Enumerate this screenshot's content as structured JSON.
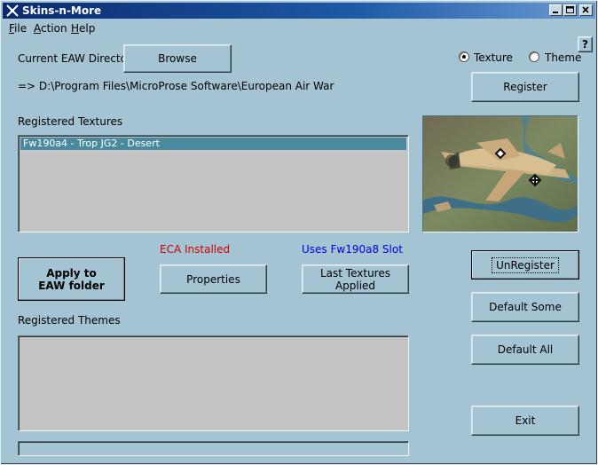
{
  "window": {
    "title": "Skins-n-More",
    "controls": [
      "minimize",
      "maximize",
      "close"
    ]
  },
  "menu": [
    {
      "label": "File",
      "accel": "F"
    },
    {
      "label": "Action",
      "accel": "A"
    },
    {
      "label": "Help",
      "accel": "H"
    }
  ],
  "help_button_label": "?",
  "directory": {
    "label": "Current EAW Directory:",
    "browse_label": "Browse",
    "path_text": "=> D:\\Program Files\\MicroProse Software\\European Air War"
  },
  "mode": {
    "options": [
      {
        "label": "Texture",
        "checked": true
      },
      {
        "label": "Theme",
        "checked": false
      }
    ]
  },
  "register_label": "Register",
  "textures": {
    "heading": "Registered Textures",
    "items": [
      "Fw190a4 - Trop JG2 - Desert"
    ],
    "selected_index": 0
  },
  "status": {
    "eca": "ECA Installed",
    "eca_color": "#d00000",
    "slot": "Uses Fw190a8 Slot",
    "slot_color": "#0000e0"
  },
  "actions": {
    "apply_label": "Apply to EAW folder",
    "properties_label": "Properties",
    "last_textures_label": "Last Textures Applied"
  },
  "side_buttons": {
    "unregister_label": "UnRegister",
    "default_some_label": "Default Some",
    "default_all_label": "Default All",
    "exit_label": "Exit"
  },
  "themes": {
    "heading": "Registered Themes",
    "items": []
  }
}
